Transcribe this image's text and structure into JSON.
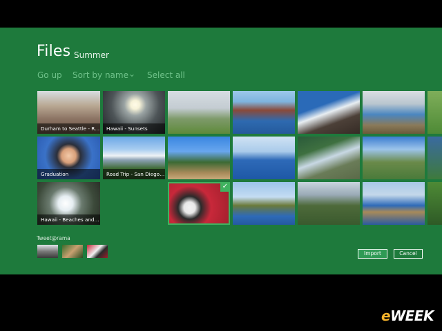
{
  "header": {
    "title": "Files",
    "subtitle": "Summer"
  },
  "commands": {
    "go_up": "Go up",
    "sort_by": "Sort by name",
    "select_all": "Select all"
  },
  "tiles": [
    {
      "label": "Durham to Seattle - Road..."
    },
    {
      "label": "Hawaii - Sunsets"
    },
    {
      "label": "Graduation"
    },
    {
      "label": "Road Trip - San Diego to ..."
    },
    {
      "label": "Hawaii - Beaches and Wa..."
    }
  ],
  "selection": {
    "check": "✓"
  },
  "tray": {
    "label": "Tweet@rama"
  },
  "actions": {
    "import": "Import",
    "cancel": "Cancel"
  },
  "watermark": {
    "e": "e",
    "rest": "WEEK"
  },
  "colors": {
    "background": "#1e7a3c",
    "accent": "#3fb25f",
    "command_text": "#6fc28a"
  }
}
